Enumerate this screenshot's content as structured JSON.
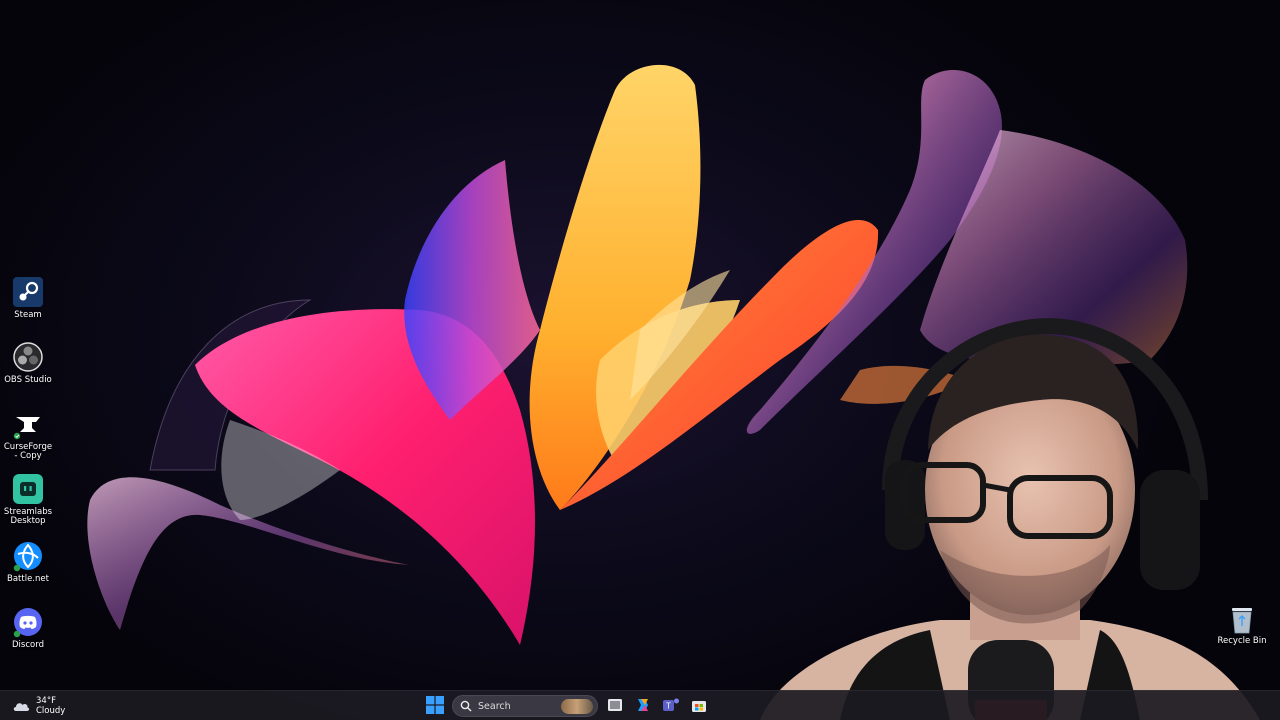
{
  "desktop_icons": [
    {
      "label": "Steam",
      "icon": "steam-icon"
    },
    {
      "label": "OBS Studio",
      "icon": "obs-icon"
    },
    {
      "label": "CurseForge - Copy",
      "icon": "curseforge-icon"
    },
    {
      "label": "Streamlabs Desktop",
      "icon": "streamlabs-icon"
    },
    {
      "label": "Battle.net",
      "icon": "battlenet-icon"
    },
    {
      "label": "Discord",
      "icon": "discord-icon"
    }
  ],
  "recycle_bin": {
    "label": "Recycle Bin",
    "icon": "recycle-bin-icon"
  },
  "taskbar": {
    "weather": {
      "temp": "34°F",
      "condition": "Cloudy",
      "icon": "cloud-icon"
    },
    "search": {
      "placeholder": "Search"
    },
    "pinned": [
      "task-view-icon",
      "copilot-icon",
      "teams-icon",
      "store-icon"
    ]
  },
  "colors": {
    "taskbar": "#1c1a22",
    "accent": "#3aa0ff"
  }
}
